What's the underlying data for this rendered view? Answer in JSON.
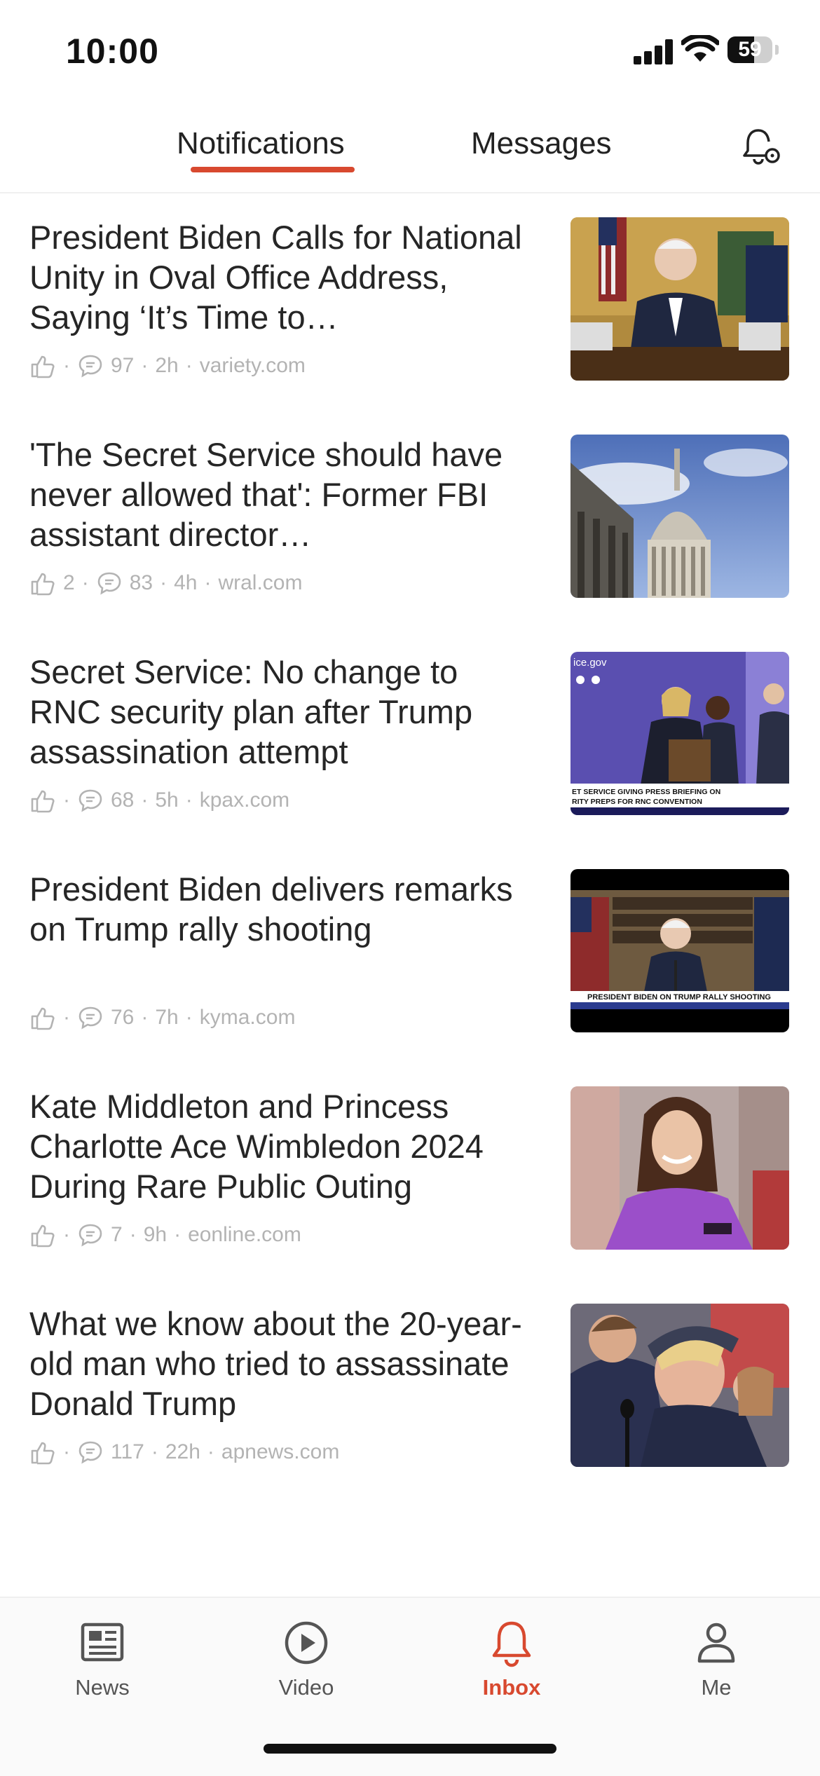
{
  "status_bar": {
    "time": "10:00",
    "battery_level": "59",
    "battery_percent": 59
  },
  "header": {
    "tabs": [
      {
        "label": "Notifications",
        "active": true
      },
      {
        "label": "Messages",
        "active": false
      }
    ],
    "settings_icon": "bell-settings-icon"
  },
  "notifications": [
    {
      "title": "President Biden Calls for National Unity in Oval Office Address, Saying ‘It’s Time to…",
      "likes": "",
      "comments": "97",
      "time": "2h",
      "source": "variety.com"
    },
    {
      "title": "'The Secret Service should have never allowed that': Former FBI assistant director…",
      "likes": "2",
      "comments": "83",
      "time": "4h",
      "source": "wral.com"
    },
    {
      "title": "Secret Service: No change to RNC security plan after Trump assassination attempt",
      "likes": "",
      "comments": "68",
      "time": "5h",
      "source": "kpax.com",
      "thumb_text": {
        "site": "ice.gov",
        "banner_line1": "ET SERVICE GIVING PRESS BRIEFING ON",
        "banner_line2": "RITY PREPS FOR RNC CONVENTION"
      }
    },
    {
      "title": "President Biden delivers remarks on Trump rally shooting",
      "likes": "",
      "comments": "76",
      "time": "7h",
      "source": "kyma.com",
      "thumb_text": {
        "banner": "PRESIDENT BIDEN ON TRUMP RALLY SHOOTING"
      }
    },
    {
      "title": "Kate Middleton and Princess Charlotte Ace Wimbledon 2024 During Rare Public Outing",
      "likes": "",
      "comments": "7",
      "time": "9h",
      "source": "eonline.com"
    },
    {
      "title": "What we know about the 20-year-old man who tried to assassinate Donald Trump",
      "likes": "",
      "comments": "117",
      "time": "22h",
      "source": "apnews.com"
    }
  ],
  "bottom_nav": [
    {
      "label": "News",
      "icon": "newspaper-icon",
      "active": false
    },
    {
      "label": "Video",
      "icon": "play-circle-icon",
      "active": false
    },
    {
      "label": "Inbox",
      "icon": "bell-icon",
      "active": true
    },
    {
      "label": "Me",
      "icon": "person-icon",
      "active": false
    }
  ],
  "colors": {
    "accent": "#d8492f",
    "meta_text": "#b3b3b3",
    "title_text": "#262626"
  }
}
